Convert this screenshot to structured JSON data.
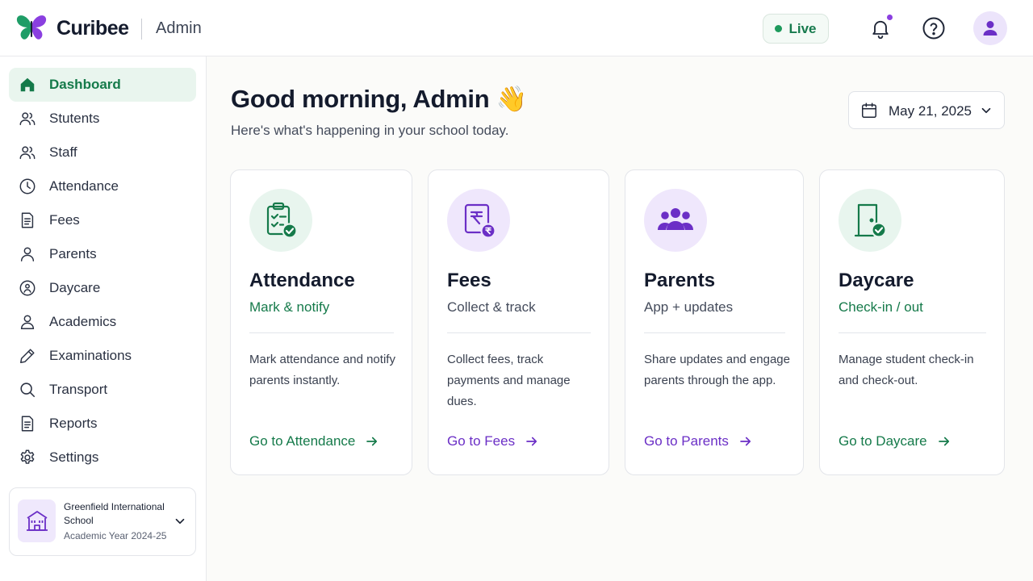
{
  "header": {
    "brand": "Curibee",
    "subtitle": "Admin",
    "live_label": "Live",
    "notification_dot": true
  },
  "sidebar": {
    "items": [
      {
        "label": "Dashboard",
        "icon": "home-icon",
        "active": true
      },
      {
        "label": "Stutents",
        "icon": "users-icon"
      },
      {
        "label": "Staff",
        "icon": "staff-icon"
      },
      {
        "label": "Attendance",
        "icon": "clock-icon"
      },
      {
        "label": "Fees",
        "icon": "document-icon"
      },
      {
        "label": "Parents",
        "icon": "person-icon"
      },
      {
        "label": "Daycare",
        "icon": "child-icon"
      },
      {
        "label": "Academics",
        "icon": "academics-icon"
      },
      {
        "label": "Examinations",
        "icon": "pencil-icon"
      },
      {
        "label": "Transport",
        "icon": "search-icon"
      },
      {
        "label": "Reports",
        "icon": "report-icon"
      },
      {
        "label": "Settings",
        "icon": "gear-icon"
      }
    ],
    "school": {
      "name": "Greenfield International School",
      "year": "Academic Year 2024-25"
    }
  },
  "main": {
    "greeting": "Good morning, Admin 👋",
    "subtitle": "Here's what's happening in your school today.",
    "date": "May 21, 2025",
    "cards": [
      {
        "title": "Attendance",
        "tag": "Mark & notify",
        "tag_color": "#157a4a",
        "description": "Mark attendance and notify parents instantly.",
        "link": "Go to Attendance",
        "link_color": "#157a4a",
        "icon": "clipboard-check-icon",
        "icon_bg": "#e8f5ee"
      },
      {
        "title": "Fees",
        "tag": "Collect & track",
        "tag_color": "#454c5c",
        "description": "Collect fees, track payments and manage dues.",
        "link": "Go to Fees",
        "link_color": "#6b2fc6",
        "icon": "rupee-invoice-icon",
        "icon_bg": "#efe7fc"
      },
      {
        "title": "Parents",
        "tag": "App + updates",
        "tag_color": "#454c5c",
        "description": "Share updates and engage parents through the app.",
        "link": "Go to Parents",
        "link_color": "#6b2fc6",
        "icon": "group-icon",
        "icon_bg": "#efe7fc"
      },
      {
        "title": "Daycare",
        "tag": "Check-in / out",
        "tag_color": "#157a4a",
        "description": "Manage student check-in and check-out.",
        "link": "Go to Daycare",
        "link_color": "#157a4a",
        "icon": "door-check-icon",
        "icon_bg": "#e8f5ee"
      }
    ]
  },
  "colors": {
    "accent_green": "#157a4a",
    "accent_purple": "#6b2fc6",
    "active_nav_bg": "#e9f5ee"
  }
}
